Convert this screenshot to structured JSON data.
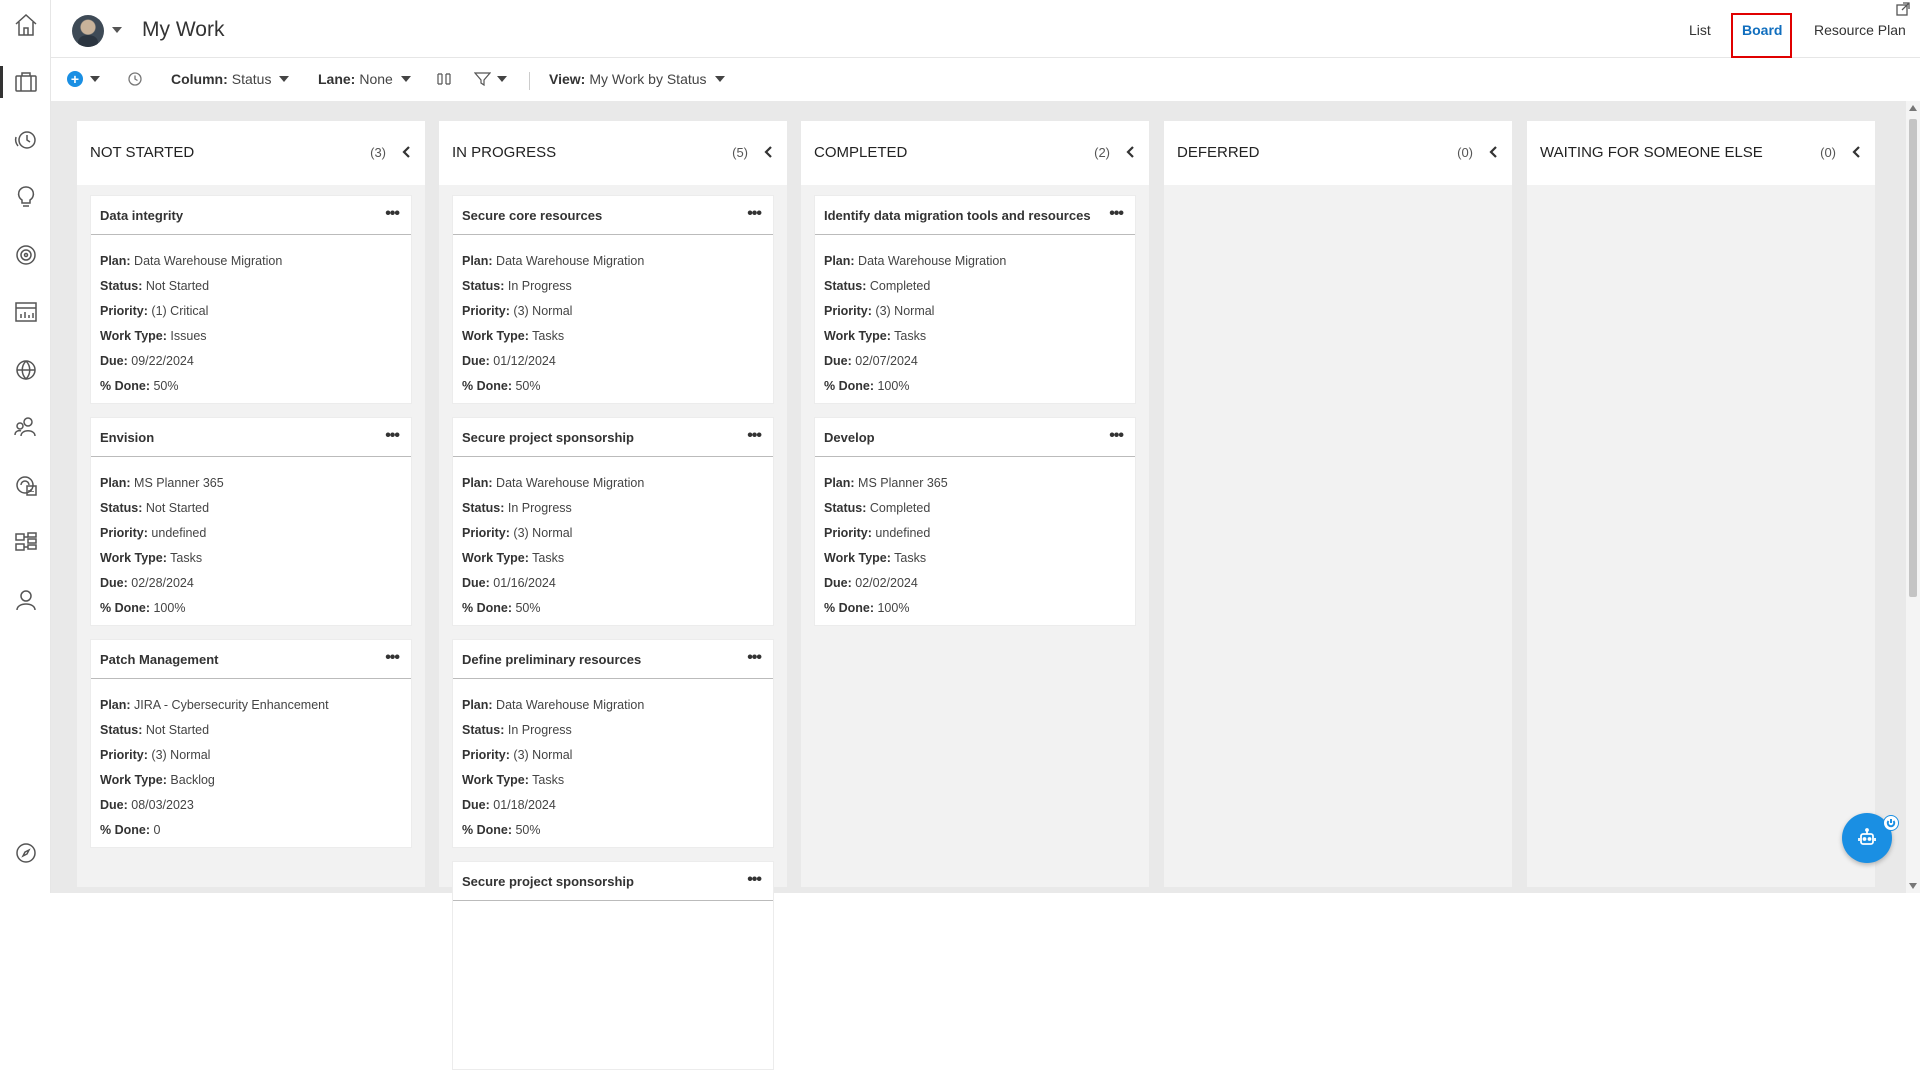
{
  "header": {
    "title": "My Work",
    "tabs": [
      {
        "label": "List",
        "active": false
      },
      {
        "label": "Board",
        "active": true
      },
      {
        "label": "Resource Plan",
        "active": false
      }
    ]
  },
  "rail": {
    "items": [
      "home-icon",
      "briefcase-icon",
      "timesheet-icon",
      "lightbulb-icon",
      "target-icon",
      "report-icon",
      "globe-icon",
      "people-icon",
      "resources-icon",
      "portfolio-icon",
      "user-icon",
      "compass-icon"
    ]
  },
  "toolbar": {
    "column_label": "Column:",
    "column_value": "Status",
    "lane_label": "Lane:",
    "lane_value": "None",
    "view_label": "View:",
    "view_value": "My Work by Status"
  },
  "columns": [
    {
      "title": "NOT STARTED",
      "count": "(3)",
      "cards": [
        {
          "title": "Data integrity",
          "plan": "Data Warehouse Migration",
          "status": "Not Started",
          "priority": "(1) Critical",
          "work_type": "Issues",
          "due": "09/22/2024",
          "done": "50%"
        },
        {
          "title": "Envision",
          "plan": "MS Planner 365",
          "status": "Not Started",
          "priority": "undefined",
          "work_type": "Tasks",
          "due": "02/28/2024",
          "done": "100%"
        },
        {
          "title": "Patch Management",
          "plan": "JIRA - Cybersecurity Enhancement",
          "status": "Not Started",
          "priority": "(3) Normal",
          "work_type": "Backlog",
          "due": "08/03/2023",
          "done": "0"
        }
      ]
    },
    {
      "title": "IN PROGRESS",
      "count": "(5)",
      "cards": [
        {
          "title": "Secure core resources",
          "plan": "Data Warehouse Migration",
          "status": "In Progress",
          "priority": "(3) Normal",
          "work_type": "Tasks",
          "due": "01/12/2024",
          "done": "50%"
        },
        {
          "title": "Secure project sponsorship",
          "plan": "Data Warehouse Migration",
          "status": "In Progress",
          "priority": "(3) Normal",
          "work_type": "Tasks",
          "due": "01/16/2024",
          "done": "50%"
        },
        {
          "title": "Define preliminary resources",
          "plan": "Data Warehouse Migration",
          "status": "In Progress",
          "priority": "(3) Normal",
          "work_type": "Tasks",
          "due": "01/18/2024",
          "done": "50%"
        },
        {
          "title": "Secure project sponsorship",
          "plan": "",
          "status": "",
          "priority": "",
          "work_type": "",
          "due": "",
          "done": ""
        }
      ]
    },
    {
      "title": "COMPLETED",
      "count": "(2)",
      "cards": [
        {
          "title": "Identify data migration tools and resources",
          "plan": "Data Warehouse Migration",
          "status": "Completed",
          "priority": "(3) Normal",
          "work_type": "Tasks",
          "due": "02/07/2024",
          "done": "100%"
        },
        {
          "title": "Develop",
          "plan": "MS Planner 365",
          "status": "Completed",
          "priority": "undefined",
          "work_type": "Tasks",
          "due": "02/02/2024",
          "done": "100%"
        }
      ]
    },
    {
      "title": "DEFERRED",
      "count": "(0)",
      "cards": []
    },
    {
      "title": "WAITING FOR SOMEONE ELSE",
      "count": "(0)",
      "cards": []
    }
  ],
  "labels": {
    "plan": "Plan:",
    "status": "Status:",
    "priority": "Priority:",
    "work_type": "Work Type:",
    "due": "Due:",
    "done": "% Done:"
  },
  "colors": {
    "accent": "#106ebe",
    "highlight": "#e00000",
    "fab": "#1a8fe3"
  }
}
